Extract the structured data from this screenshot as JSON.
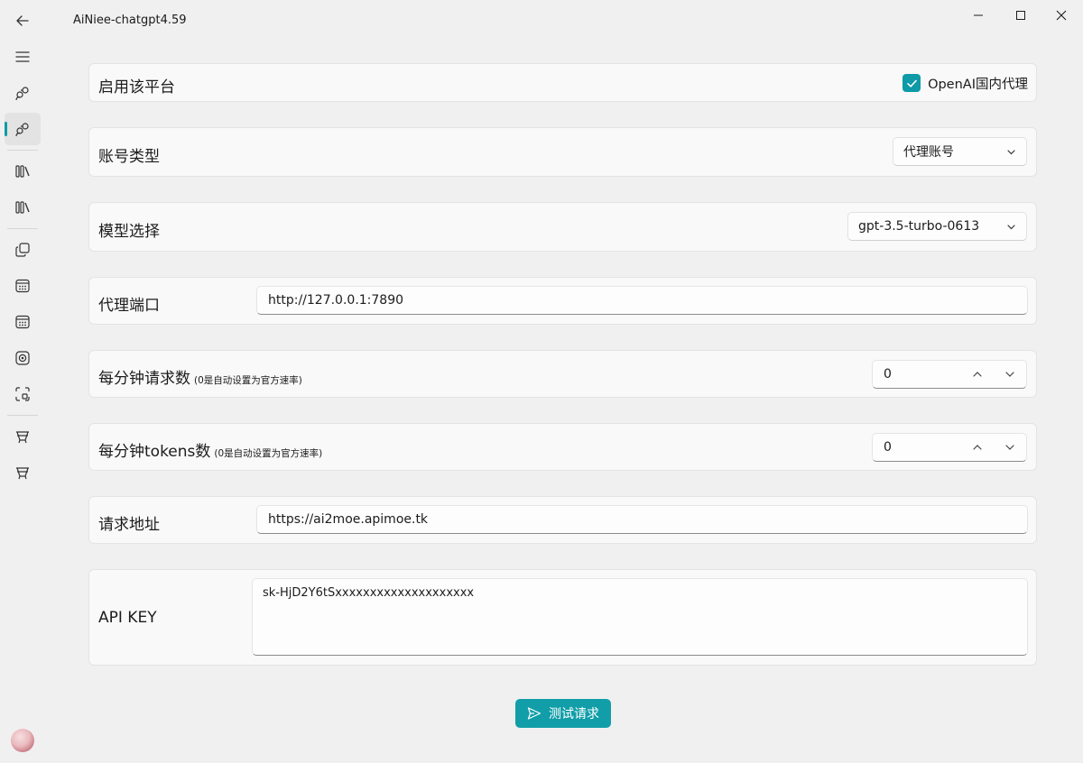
{
  "window": {
    "title": "AiNiee-chatgpt4.59",
    "controls": [
      "minimize-icon",
      "maximize-icon",
      "close-icon"
    ]
  },
  "sidebar": {
    "items": [
      {
        "icon": "back-arrow-icon"
      },
      {
        "icon": "menu-icon"
      },
      {
        "icon": "people-icon"
      },
      {
        "icon": "people-icon",
        "selected": true
      },
      {
        "icon": "library-icon"
      },
      {
        "icon": "library-icon"
      },
      {
        "icon": "copy-icon"
      },
      {
        "icon": "calendar-icon"
      },
      {
        "icon": "calendar-icon"
      },
      {
        "icon": "target-icon"
      },
      {
        "icon": "focus-frame-icon"
      },
      {
        "icon": "basket-icon"
      },
      {
        "icon": "basket-icon"
      }
    ],
    "avatar": "avatar"
  },
  "settings": {
    "enable_platform": {
      "label": "启用该平台",
      "checkbox_label": "OpenAI国内代理",
      "checked": true
    },
    "account_type": {
      "label": "账号类型",
      "value": "代理账号"
    },
    "model": {
      "label": "模型选择",
      "value": "gpt-3.5-turbo-0613"
    },
    "proxy_port": {
      "label": "代理端口",
      "value": "http://127.0.0.1:7890"
    },
    "rpm": {
      "label": "每分钟请求数",
      "note": "(0是自动设置为官方速率)",
      "value": "0"
    },
    "tpm": {
      "label": "每分钟tokens数",
      "note": "(0是自动设置为官方速率)",
      "value": "0"
    },
    "request_url": {
      "label": "请求地址",
      "value": "https://ai2moe.apimoe.tk"
    },
    "api_key": {
      "label": "API KEY",
      "value": "sk-HjD2Y6tSxxxxxxxxxxxxxxxxxxxx"
    }
  },
  "actions": {
    "test_request": "测试请求"
  },
  "colors": {
    "accent": "#0e9aa7",
    "background": "#f0f0f0",
    "card": "#f9f9f9"
  }
}
